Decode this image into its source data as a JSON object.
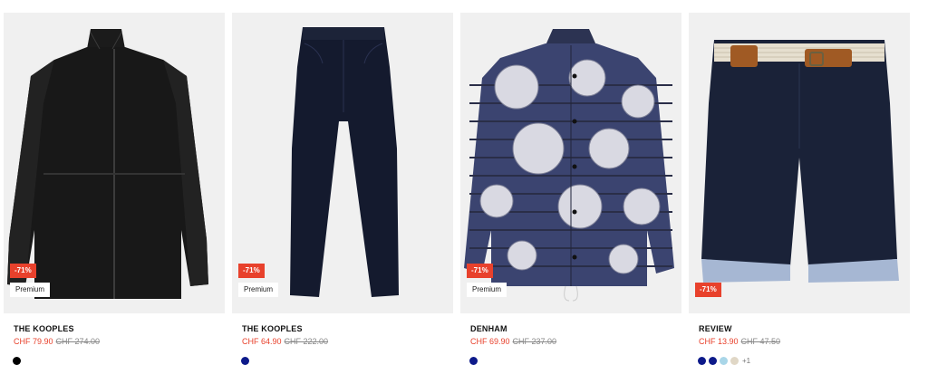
{
  "products": [
    {
      "brand": "THE KOOPLES",
      "price": "CHF 79.90",
      "old_price": "CHF 274.00",
      "discount": "-71%",
      "badge": "Premium",
      "image": "black-windbreaker-jacket",
      "colors": [
        "#000000"
      ],
      "more_colors": ""
    },
    {
      "brand": "THE KOOPLES",
      "price": "CHF 64.90",
      "old_price": "CHF 222.00",
      "discount": "-71%",
      "badge": "Premium",
      "image": "navy-trousers",
      "colors": [
        "#0d1a8a"
      ],
      "more_colors": ""
    },
    {
      "brand": "DENHAM",
      "price": "CHF 69.90",
      "old_price": "CHF 237.00",
      "discount": "-71%",
      "badge": "Premium",
      "image": "printed-coach-jacket",
      "colors": [
        "#0d1a8a"
      ],
      "more_colors": ""
    },
    {
      "brand": "REVIEW",
      "price": "CHF 13.90",
      "old_price": "CHF 47.50",
      "discount": "-71%",
      "badge": "",
      "image": "navy-chino-shorts-with-belt",
      "colors": [
        "#0d1a8a",
        "#0d1a8a",
        "#a9d6e8",
        "#e0d7c6"
      ],
      "more_colors": "+1"
    }
  ]
}
